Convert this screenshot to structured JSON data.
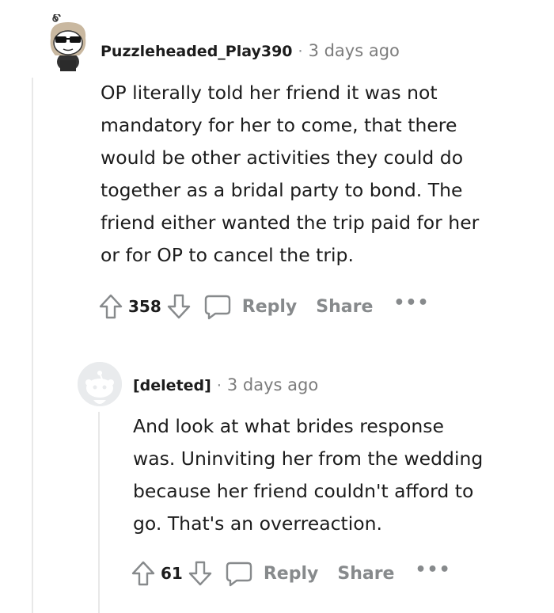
{
  "comments": [
    {
      "author": "Puzzleheaded_Play390",
      "separator": "·",
      "time": "3 days ago",
      "body": "OP literally told her friend it was not\nmandatory for her to come, that there\nwould be other activities they could do\ntogether as a bridal party to bond. The\nfriend either wanted the trip paid for her\nor for OP to cancel the trip.",
      "score": "358",
      "reply_label": "Reply",
      "share_label": "Share",
      "more_label": "•••",
      "avatar_icon": "snoo-sunglasses-avatar-icon"
    },
    {
      "author": "[deleted]",
      "separator": "·",
      "time": "3 days ago",
      "body": "And look at what brides response\nwas. Uninviting her from the wedding\nbecause her friend couldn't afford to\ngo. That's an overreaction.",
      "score": "61",
      "reply_label": "Reply",
      "share_label": "Share",
      "more_label": "•••",
      "avatar_icon": "deleted-user-avatar-icon"
    }
  ],
  "colors": {
    "meta": "#878a8c",
    "text": "#1c1c1c",
    "thread_line": "#e8e8e8"
  }
}
